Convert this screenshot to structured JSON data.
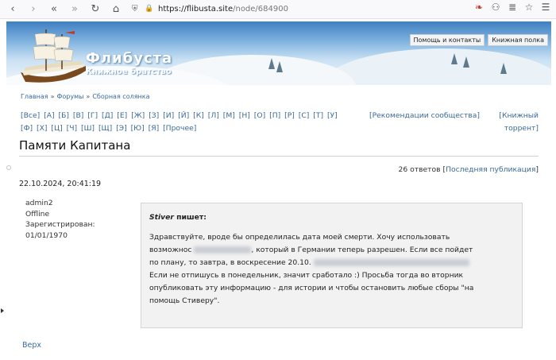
{
  "browser": {
    "url_host": "https://flibusta.site",
    "url_path": "/node/684900"
  },
  "banner": {
    "brand": "Флибуста",
    "tagline": "Книжное братство",
    "links": [
      "Помощь и контакты",
      "Книжная полка"
    ]
  },
  "breadcrumb": [
    "Главная",
    "Форумы",
    "Сборная солянка"
  ],
  "alphabet": [
    "[Все]",
    "[А]",
    "[Б]",
    "[В]",
    "[Г]",
    "[Д]",
    "[Е]",
    "[Ж]",
    "[З]",
    "[И]",
    "[Й]",
    "[К]",
    "[Л]",
    "[М]",
    "[Н]",
    "[О]",
    "[П]",
    "[Р]",
    "[С]",
    "[Т]",
    "[У]",
    "[Ф]",
    "[Х]",
    "[Ц]",
    "[Ч]",
    "[Ш]",
    "[Щ]",
    "[Э]",
    "[Ю]",
    "[Я]",
    "[Прочее]"
  ],
  "nav": {
    "recommendations": "[Рекомендации сообщества]",
    "torrent": "[Книжный торрент]"
  },
  "topic": {
    "title": "Памяти Капитана",
    "answers_count": "26 ответов",
    "last_post_link": "Последняя публикация"
  },
  "post": {
    "date": "22.10.2024, 20:41:19",
    "author": {
      "name": "admin2",
      "status": "Offline",
      "registered_label": "Зарегистрирован:",
      "registered_date": "01/01/1970"
    },
    "quote": {
      "author": "Stiver",
      "says": "пишет:",
      "line1": "Здравствуйте, вроде бы определилась дата моей смерти. Хочу использовать",
      "line2a": "возможнос",
      "line2b": ", который в Германии теперь разрешен. Если все пойдет",
      "line3": "по плану, то завтра, в воскресение 20.10.",
      "line4": "Если не отпишусь в понедельник, значит сработало :) Просьба тогда во вторник",
      "line5": "опубликовать эту информацию - для истории и чтобы остановить любые сборы \"на",
      "line6": "помощь Стиверу\"."
    }
  },
  "footer": {
    "top_link": "Верх"
  },
  "colors": {
    "link": "#3a6a9a",
    "quote_bg": "#f2f2f2"
  }
}
